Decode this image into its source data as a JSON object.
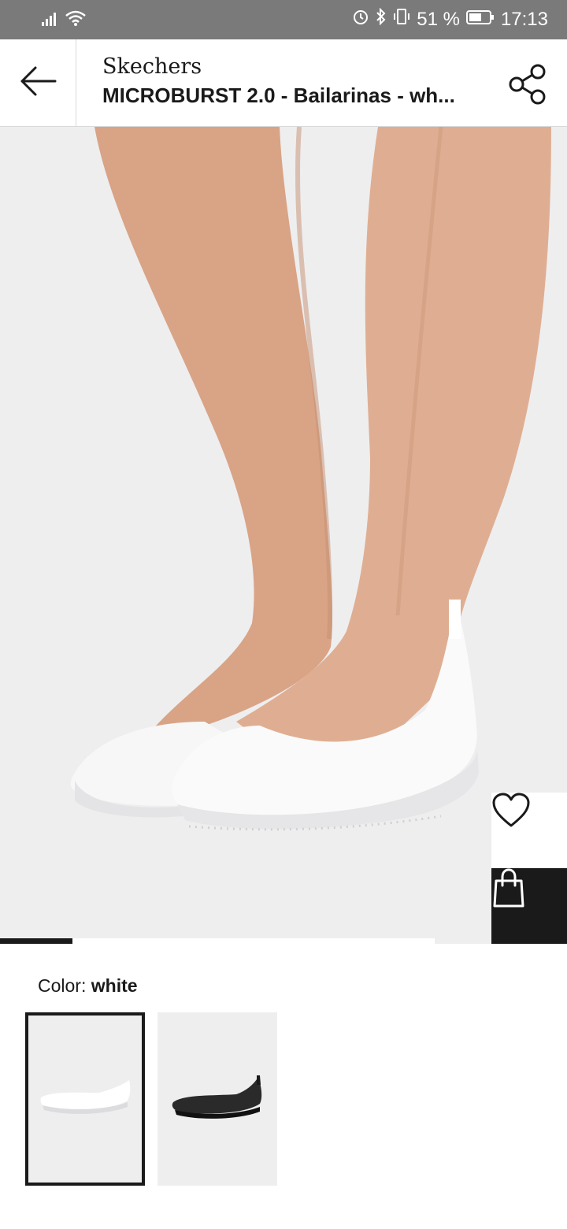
{
  "status_bar": {
    "battery_percent": "51 %",
    "time": "17:13",
    "icons": [
      "signal-icon",
      "wifi-icon",
      "alarm-icon",
      "bluetooth-icon",
      "vibrate-icon",
      "battery-icon"
    ]
  },
  "header": {
    "brand": "Skechers",
    "title": "MICROBURST 2.0 - Bailarinas - wh...",
    "back_icon": "arrow-left-icon",
    "share_icon": "share-icon"
  },
  "product_image": {
    "actions": {
      "wishlist_icon": "heart-icon",
      "bag_icon": "shopping-bag-icon"
    },
    "carousel_progress": 0.167
  },
  "color": {
    "label": "Color:",
    "selected": "white",
    "options": [
      {
        "name": "white",
        "swatch": "#f4f4f4",
        "selected": true
      },
      {
        "name": "black",
        "swatch": "#2a2a2a",
        "selected": false
      }
    ]
  },
  "colors": {
    "status_bar_bg": "#7a7a7a",
    "image_bg": "#eeeeef",
    "ink": "#1a1a1a"
  }
}
